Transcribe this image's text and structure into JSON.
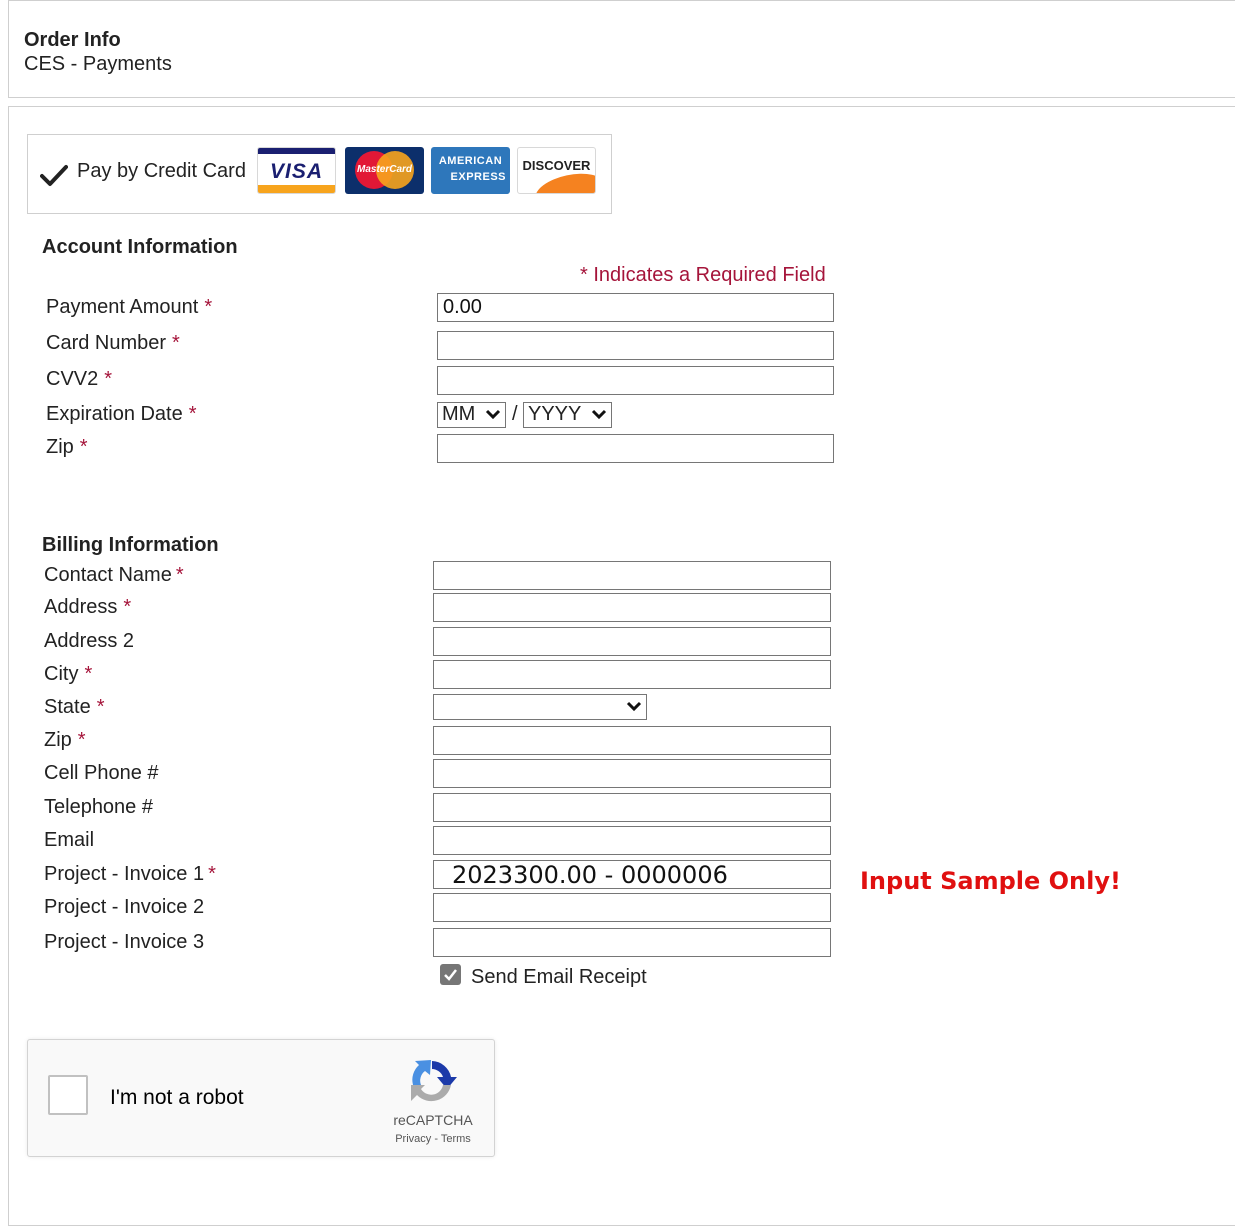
{
  "header": {
    "title": "Order Info",
    "subtitle": "CES - Payments"
  },
  "payment_method": {
    "label": "Pay by Credit Card",
    "cards": {
      "visa": "VISA",
      "mastercard": "MasterCard",
      "amex_line1": "AMERICAN",
      "amex_line2": "EXPRESS",
      "discover": "DISCOVER"
    }
  },
  "account_info": {
    "title": "Account Information",
    "required_note": "* Indicates a Required Field",
    "required_marker": "*",
    "payment_amount_label": "Payment Amount",
    "payment_amount_value": "0.00",
    "card_number_label": "Card Number",
    "cvv2_label": "CVV2",
    "expiration_label": "Expiration Date",
    "exp_month_selected": "MM",
    "exp_separator": "/",
    "exp_year_selected": "YYYY",
    "zip_label": "Zip"
  },
  "billing_info": {
    "title": "Billing Information",
    "contact_name_label": "Contact Name",
    "address_label": "Address",
    "address2_label": "Address 2",
    "city_label": "City",
    "state_label": "State",
    "state_selected": "",
    "zip_label": "Zip",
    "cell_phone_label": "Cell Phone #",
    "telephone_label": "Telephone #",
    "email_label": "Email",
    "invoice1_label": "Project - Invoice 1",
    "invoice1_value": "2023300.00 - 0000006",
    "invoice2_label": "Project - Invoice 2",
    "invoice3_label": "Project - Invoice 3",
    "input_sample_note": "Input Sample Only!",
    "send_receipt_label": "Send Email Receipt",
    "send_receipt_checked": true
  },
  "captcha": {
    "label": "I'm not a robot",
    "brand": "reCAPTCHA",
    "links": "Privacy - Terms"
  },
  "colors": {
    "required": "#a5143a",
    "sample_note": "#e01010",
    "border": "#cfcfcf"
  }
}
